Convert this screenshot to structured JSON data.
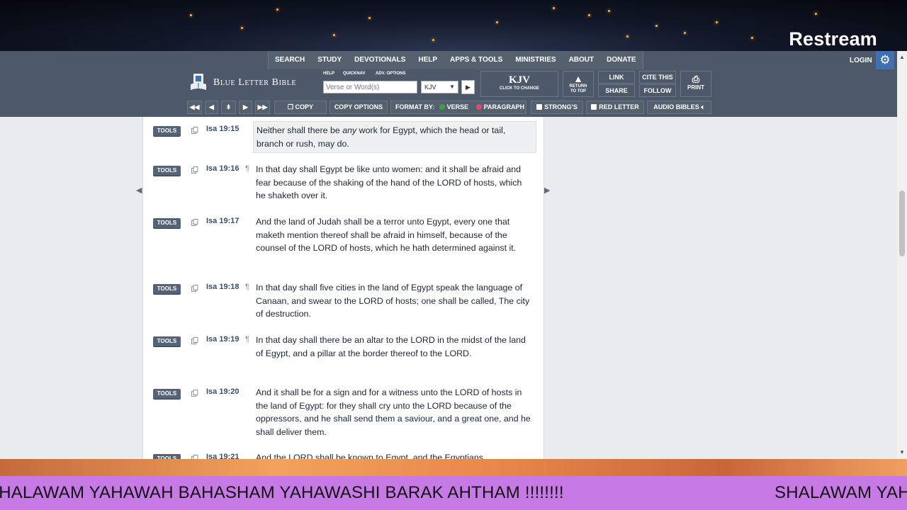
{
  "stream": {
    "brand": "Restream"
  },
  "nav": {
    "menu": [
      "SEARCH",
      "STUDY",
      "DEVOTIONALS",
      "HELP",
      "APPS & TOOLS",
      "MINISTRIES",
      "ABOUT",
      "DONATE"
    ],
    "login": "LOGIN"
  },
  "header": {
    "site_name": "Blue Letter Bible",
    "help": "HELP",
    "quicknav": "QUICKNAV",
    "adv_options": "ADV. OPTIONS",
    "search_placeholder": "Verse or Word(s)",
    "version": "KJV",
    "kjv_big": "KJV",
    "kjv_small": "CLICK TO CHANGE",
    "return_top_1": "RETURN",
    "return_top_2": "TO TOP",
    "link": "LINK",
    "share": "SHARE",
    "cite": "CITE THIS",
    "follow": "FOLLOW",
    "print": "PRINT"
  },
  "toolbar": {
    "copy": "COPY",
    "copy_options": "COPY OPTIONS",
    "format_by": "FORMAT BY:",
    "verse": "VERSE",
    "paragraph": "PARAGRAPH",
    "strongs": "STRONG'S",
    "red_letter": "RED LETTER",
    "audio_bibles": "AUDIO BIBLES"
  },
  "verses": [
    {
      "ref": "Isa 19:15",
      "pilcrow": "",
      "text_before": "Neither shall there be ",
      "text_italic": "any",
      "text_after": " work for Egypt, which the head or tail, branch or rush, may do."
    },
    {
      "ref": "Isa 19:16",
      "pilcrow": "¶",
      "text": "In that day shall Egypt be like unto women: and it shall be afraid and fear because of the shaking of the hand of the LORD of hosts, which he shaketh over it."
    },
    {
      "ref": "Isa 19:17",
      "pilcrow": "",
      "text": "And the land of Judah shall be a terror unto Egypt, every one that maketh mention thereof shall be afraid in himself, because of the counsel of the LORD of hosts, which he hath determined against it."
    },
    {
      "ref": "Isa 19:18",
      "pilcrow": "¶",
      "text": "In that day shall five cities in the land of Egypt speak the language of Canaan, and swear to the LORD of hosts; one shall be called, The city of destruction."
    },
    {
      "ref": "Isa 19:19",
      "pilcrow": "¶",
      "text": "In that day shall there be an altar to the LORD in the midst of the land of Egypt, and a pillar at the border thereof to the LORD."
    },
    {
      "ref": "Isa 19:20",
      "pilcrow": "",
      "text": "And it shall be for a sign and for a witness unto the LORD of hosts in the land of Egypt: for they shall cry unto the LORD because of the oppressors, and he shall send them a saviour, and a great one, and he shall deliver them."
    },
    {
      "ref": "Isa 19:21",
      "pilcrow": "",
      "text": "And the LORD shall be known to Egypt, and the Egyptians"
    }
  ],
  "tools_label": "TOOLS",
  "ticker": {
    "text": "SHALAWAM YAHAWAH BAHASHAM YAHAWASHI BARAK AHTHAM !!!!!!!!"
  }
}
